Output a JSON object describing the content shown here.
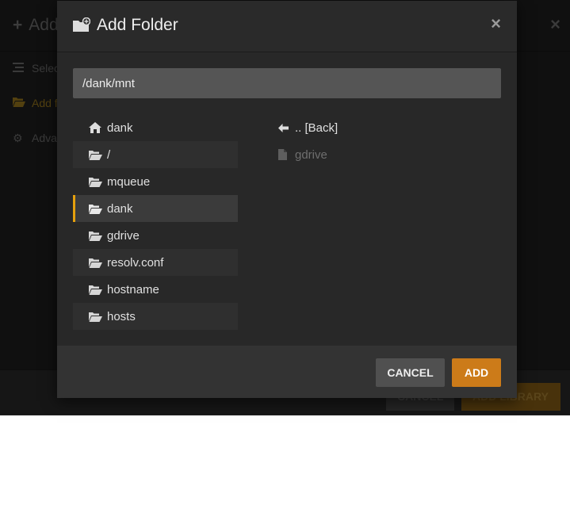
{
  "background": {
    "title_visible": "Add",
    "nav_items": [
      {
        "label": "Selec",
        "icon": "list-icon"
      },
      {
        "label": "Add f",
        "icon": "folder-open-icon"
      },
      {
        "label": "Adva",
        "icon": "gear-icon"
      }
    ],
    "cancel_label": "CANCEL",
    "add_library_label": "ADD LIBRARY"
  },
  "modal": {
    "title": "Add Folder",
    "close_symbol": "×",
    "path_value": "/dank/mnt",
    "directories": [
      {
        "label": "dank",
        "icon": "home-icon"
      },
      {
        "label": "/",
        "icon": "folder-open-icon"
      },
      {
        "label": "mqueue",
        "icon": "folder-open-icon"
      },
      {
        "label": "dank",
        "icon": "folder-open-icon",
        "selected": true
      },
      {
        "label": "gdrive",
        "icon": "folder-open-icon"
      },
      {
        "label": "resolv.conf",
        "icon": "folder-open-icon"
      },
      {
        "label": "hostname",
        "icon": "folder-open-icon"
      },
      {
        "label": "hosts",
        "icon": "folder-open-icon"
      }
    ],
    "files": [
      {
        "label": ".. [Back]",
        "icon": "arrow-left-icon"
      },
      {
        "label": "gdrive",
        "icon": "file-icon",
        "disabled": true
      }
    ],
    "cancel_label": "CANCEL",
    "add_label": "ADD"
  },
  "colors": {
    "accent": "#e5a00d",
    "add_button": "#cc7b19",
    "modal_bg": "#282828"
  }
}
